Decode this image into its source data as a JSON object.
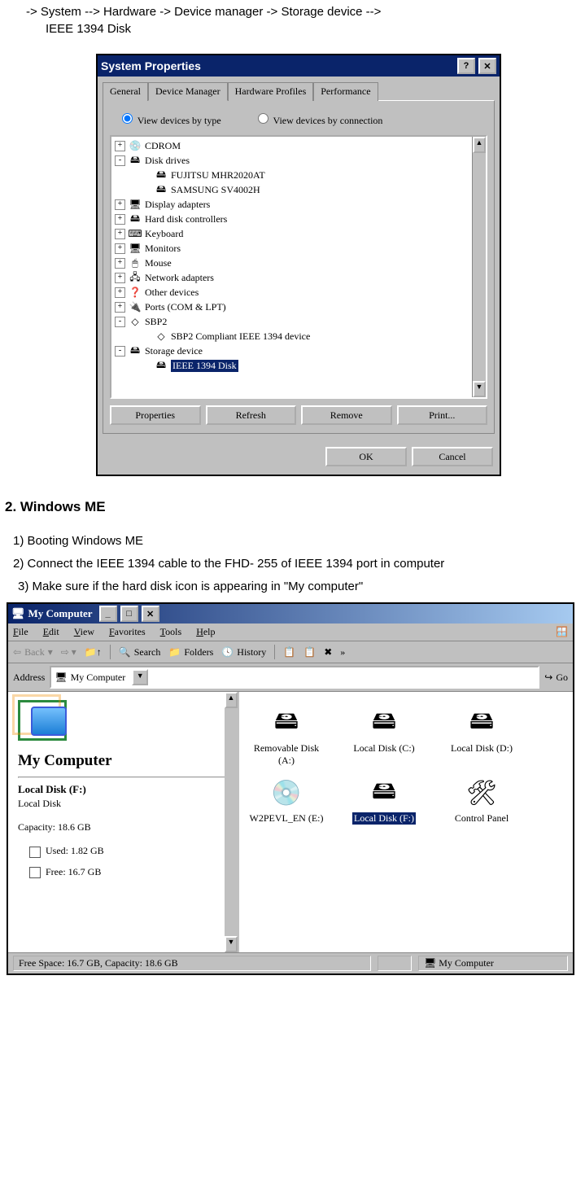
{
  "intro_line1": "-> System --> Hardware -> Device manager -> Storage device -->",
  "intro_line2": "IEEE 1394 Disk",
  "sysprops": {
    "title": "System Properties",
    "tabs": [
      "General",
      "Device Manager",
      "Hardware Profiles",
      "Performance"
    ],
    "radio1": "View devices by type",
    "radio2": "View devices by connection",
    "tree": [
      {
        "exp": "+",
        "icon": "💿",
        "label": "CDROM"
      },
      {
        "exp": "-",
        "icon": "🖴",
        "label": "Disk drives"
      },
      {
        "child": true,
        "icon": "🖴",
        "label": "FUJITSU MHR2020AT"
      },
      {
        "child": true,
        "icon": "🖴",
        "label": "SAMSUNG SV4002H"
      },
      {
        "exp": "+",
        "icon": "🖥",
        "label": "Display adapters"
      },
      {
        "exp": "+",
        "icon": "🖴",
        "label": "Hard disk controllers"
      },
      {
        "exp": "+",
        "icon": "⌨",
        "label": "Keyboard"
      },
      {
        "exp": "+",
        "icon": "🖥",
        "label": "Monitors"
      },
      {
        "exp": "+",
        "icon": "🖱",
        "label": "Mouse"
      },
      {
        "exp": "+",
        "icon": "🖧",
        "label": "Network adapters"
      },
      {
        "exp": "+",
        "icon": "❓",
        "label": "Other devices"
      },
      {
        "exp": "+",
        "icon": "🔌",
        "label": "Ports (COM & LPT)"
      },
      {
        "exp": "-",
        "icon": "◇",
        "label": "SBP2"
      },
      {
        "child": true,
        "icon": "◇",
        "label": "SBP2 Compliant IEEE 1394 device"
      },
      {
        "exp": "-",
        "icon": "🖴",
        "label": "Storage device"
      },
      {
        "child": true,
        "icon": "🖴",
        "label": "IEEE 1394 Disk",
        "selected": true
      }
    ],
    "buttons": [
      "Properties",
      "Refresh",
      "Remove",
      "Print..."
    ],
    "ok": "OK",
    "cancel": "Cancel"
  },
  "section2_title": "2. Windows ME",
  "steps": [
    "1) Booting Windows ME",
    "2) Connect the IEEE 1394 cable to the FHD- 255 of IEEE 1394 port in computer",
    "3) Make sure if the hard disk icon is appearing in \"My computer\""
  ],
  "mycomp": {
    "title": "My Computer",
    "menu": [
      "File",
      "Edit",
      "View",
      "Favorites",
      "Tools",
      "Help"
    ],
    "toolbar": {
      "back": "Back",
      "search": "Search",
      "folders": "Folders",
      "history": "History"
    },
    "addr_label": "Address",
    "addr_value": "My Computer",
    "go": "Go",
    "left": {
      "header": "My Computer",
      "selname": "Local Disk (F:)",
      "seltype": "Local Disk",
      "capacity_label": "Capacity: 18.6 GB",
      "used": "Used: 1.82 GB",
      "free": "Free: 16.7 GB"
    },
    "icons": [
      {
        "icon": "🖴",
        "label": "Removable Disk (A:)"
      },
      {
        "icon": "🖴",
        "label": "Local Disk (C:)"
      },
      {
        "icon": "🖴",
        "label": "Local Disk (D:)"
      },
      {
        "icon": "💿",
        "label": "W2PEVL_EN (E:)"
      },
      {
        "icon": "🖴",
        "label": "Local Disk (F:)",
        "selected": true
      },
      {
        "icon": "🛠",
        "label": "Control Panel"
      }
    ],
    "status_left": "Free Space: 16.7 GB, Capacity: 18.6 GB",
    "status_right": "My Computer"
  }
}
